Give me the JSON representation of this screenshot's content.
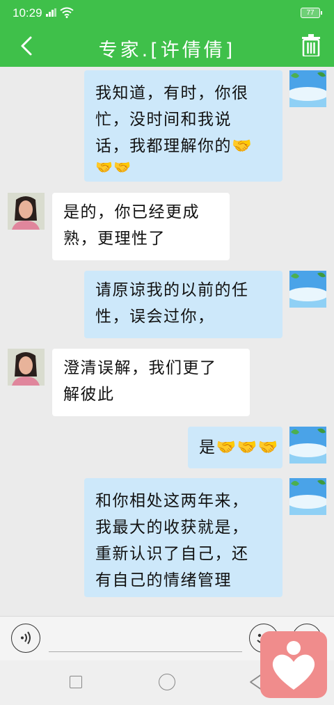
{
  "status_bar": {
    "time": "10:29",
    "battery": "77"
  },
  "header": {
    "title": "专家.[许倩倩]",
    "back_icon": "back-arrow-icon",
    "delete_icon": "trash-icon"
  },
  "messages": [
    {
      "direction": "out",
      "lines": [
        "我知道，有时，你很",
        "忙，没时间和我说",
        "话，我都理解你的🤝",
        "🤝🤝"
      ]
    },
    {
      "direction": "in",
      "lines": [
        "是的，你已经更成",
        "熟，更理性了"
      ]
    },
    {
      "direction": "out",
      "lines": [
        "请原谅我的以前的任",
        "性，误会过你，"
      ]
    },
    {
      "direction": "in",
      "lines": [
        "澄清误解，我们更了",
        "解彼此"
      ]
    },
    {
      "direction": "out",
      "lines": [
        "是🤝🤝🤝"
      ]
    },
    {
      "direction": "out",
      "lines": [
        "和你相处这两年来，",
        "我最大的收获就是，",
        "重新认识了自己，还",
        "有自己的情绪管理"
      ]
    }
  ],
  "input_bar": {
    "voice_icon": "voice-icon",
    "emoji_icon": "emoji-icon",
    "plus_icon": "plus-icon",
    "value": ""
  },
  "floating_button": {
    "icon": "heart-person-icon",
    "color": "#f08c8c"
  },
  "colors": {
    "header": "#3fc04a",
    "outgoing_bubble": "#cde8fa",
    "incoming_bubble": "#ffffff",
    "background": "#ebebeb"
  }
}
